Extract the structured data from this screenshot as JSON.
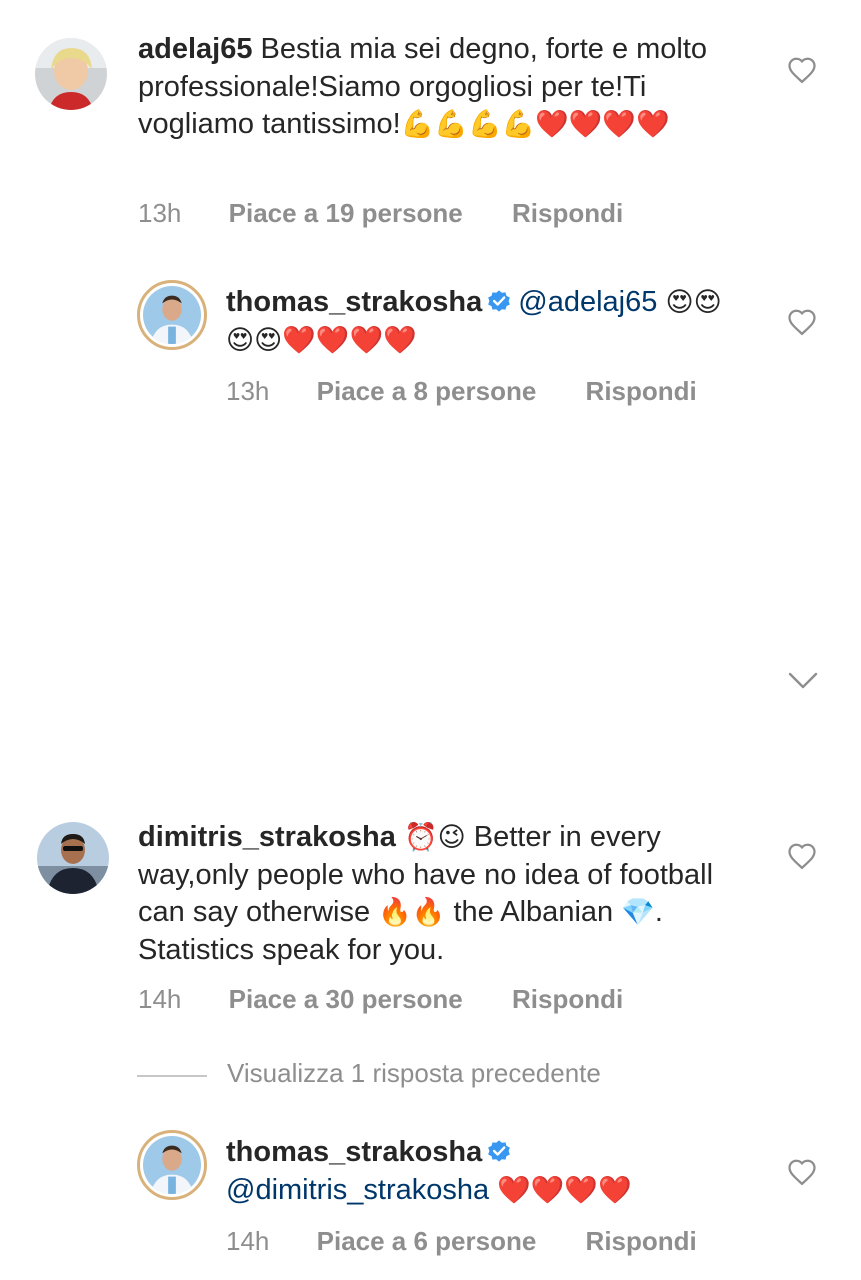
{
  "comments": [
    {
      "username": "adelaj65",
      "text": "Bestia mia sei degno, forte e molto professionale!Siamo orgogliosi per te!Ti vogliamo tantissimo!",
      "emojis": "💪💪💪💪❤️❤️❤️❤️",
      "time": "13h",
      "likes": "Piace a 19 persone",
      "reply": "Rispondi"
    },
    {
      "username": "thomas_strakosha",
      "verified": true,
      "mention": "@adelaj65",
      "emojis": "😍😍😍😍❤️❤️❤️❤️",
      "time": "13h",
      "likes": "Piace a 8 persone",
      "reply": "Rispondi"
    },
    {
      "username": "dimitris_strakosha",
      "emoji_before": "⏰😉",
      "text_part1": "Better in every way,only people who have no idea of football can say otherwise",
      "emoji_mid": "🔥🔥",
      "text_part2": "the Albanian",
      "emoji_end": "💎",
      "text_part3": ". Statistics speak for you.",
      "time": "14h",
      "likes": "Piace a 30 persone",
      "reply": "Rispondi"
    },
    {
      "username": "thomas_strakosha",
      "verified": true,
      "mention": "@dimitris_strakosha",
      "emojis": "❤️❤️❤️❤️",
      "time": "14h",
      "likes": "Piace a 6 persone",
      "reply": "Rispondi"
    }
  ],
  "view_replies": "Visualizza 1 risposta precedente",
  "icons": {
    "like": "heart-outline-icon",
    "expand": "chevron-down-icon",
    "verified": "verified-badge-icon"
  },
  "colors": {
    "text": "#262626",
    "meta": "#8e8e8e",
    "mention": "#00376b",
    "verified": "#3897f0"
  }
}
